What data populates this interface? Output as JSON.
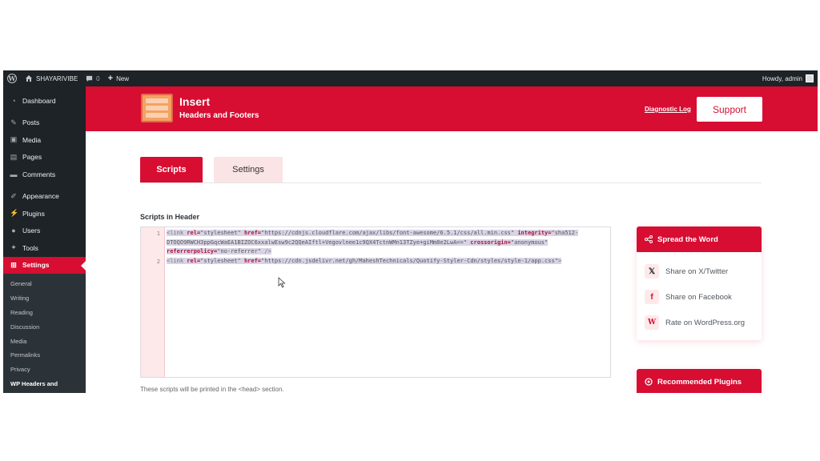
{
  "admin_bar": {
    "site_name": "SHAYARIVIBE",
    "comments_count": "0",
    "new_label": "New",
    "howdy": "Howdy, admin"
  },
  "sidebar": {
    "items": [
      {
        "label": "Dashboard",
        "icon": "dashboard-icon"
      },
      {
        "label": "Posts",
        "icon": "pin-icon"
      },
      {
        "label": "Media",
        "icon": "media-icon"
      },
      {
        "label": "Pages",
        "icon": "page-icon"
      },
      {
        "label": "Comments",
        "icon": "comment-icon"
      },
      {
        "label": "Appearance",
        "icon": "brush-icon"
      },
      {
        "label": "Plugins",
        "icon": "plug-icon"
      },
      {
        "label": "Users",
        "icon": "user-icon"
      },
      {
        "label": "Tools",
        "icon": "wrench-icon"
      },
      {
        "label": "Settings",
        "icon": "settings-icon"
      }
    ],
    "submenu": [
      "General",
      "Writing",
      "Reading",
      "Discussion",
      "Media",
      "Permalinks",
      "Privacy",
      "WP Headers and"
    ]
  },
  "plugin_header": {
    "title": "Insert",
    "subtitle": "Headers and Footers",
    "diagnostic_link": "Diagnostic Log",
    "support_label": "Support"
  },
  "tabs": [
    {
      "label": "Scripts",
      "active": true
    },
    {
      "label": "Settings",
      "active": false
    }
  ],
  "scripts_header": {
    "label": "Scripts in Header",
    "line_numbers": [
      "1",
      "2"
    ],
    "line1": {
      "open": "<link",
      "rel_attr": "rel=",
      "rel_val": "\"stylesheet\"",
      "href_attr": "href=",
      "href_val": "\"https://cdnjs.cloudflare.com/ajax/libs/font-awesome/6.5.1/css/all.min.css\"",
      "integrity_attr": "integrity=",
      "integrity_val": "\"sha512-DTOQO9RWCH3ppGqcWaEA1BIZOC6xxalwEsw9c2QQeAIftl+Vegovlnee1c9QX4TctnWMn13TZye+giMm8e2LwA==\"",
      "crossorigin_attr": "crossorigin=",
      "crossorigin_val": "\"anonymous\"",
      "referrer_attr": "referrerpolicy=",
      "referrer_val": "\"no-referrer\"",
      "close": "/>"
    },
    "line2": {
      "open": "<link",
      "rel_attr": "rel=",
      "rel_val": "\"stylesheet\"",
      "href_attr": "href=",
      "href_val": "\"https://cdn.jsdelivr.net/gh/MaheshTechnicals/Quotify-Styler-Cdn/styles/style-1/app.css\"",
      "close": ">"
    },
    "hint": "These scripts will be printed in the <head> section."
  },
  "spread_the_word": {
    "title": "Spread the Word",
    "links": [
      {
        "label": "Share on X/Twitter",
        "icon": "x-twitter-icon",
        "glyph": "𝕏"
      },
      {
        "label": "Share on Facebook",
        "icon": "facebook-icon",
        "glyph": "f"
      },
      {
        "label": "Rate on WordPress.org",
        "icon": "wordpress-icon",
        "glyph": "W"
      }
    ]
  },
  "recommended_plugins": {
    "title": "Recommended Plugins"
  },
  "colors": {
    "accent": "#d70d32",
    "admin_dark": "#1d2327",
    "tab_inactive": "#fbe4e6"
  }
}
